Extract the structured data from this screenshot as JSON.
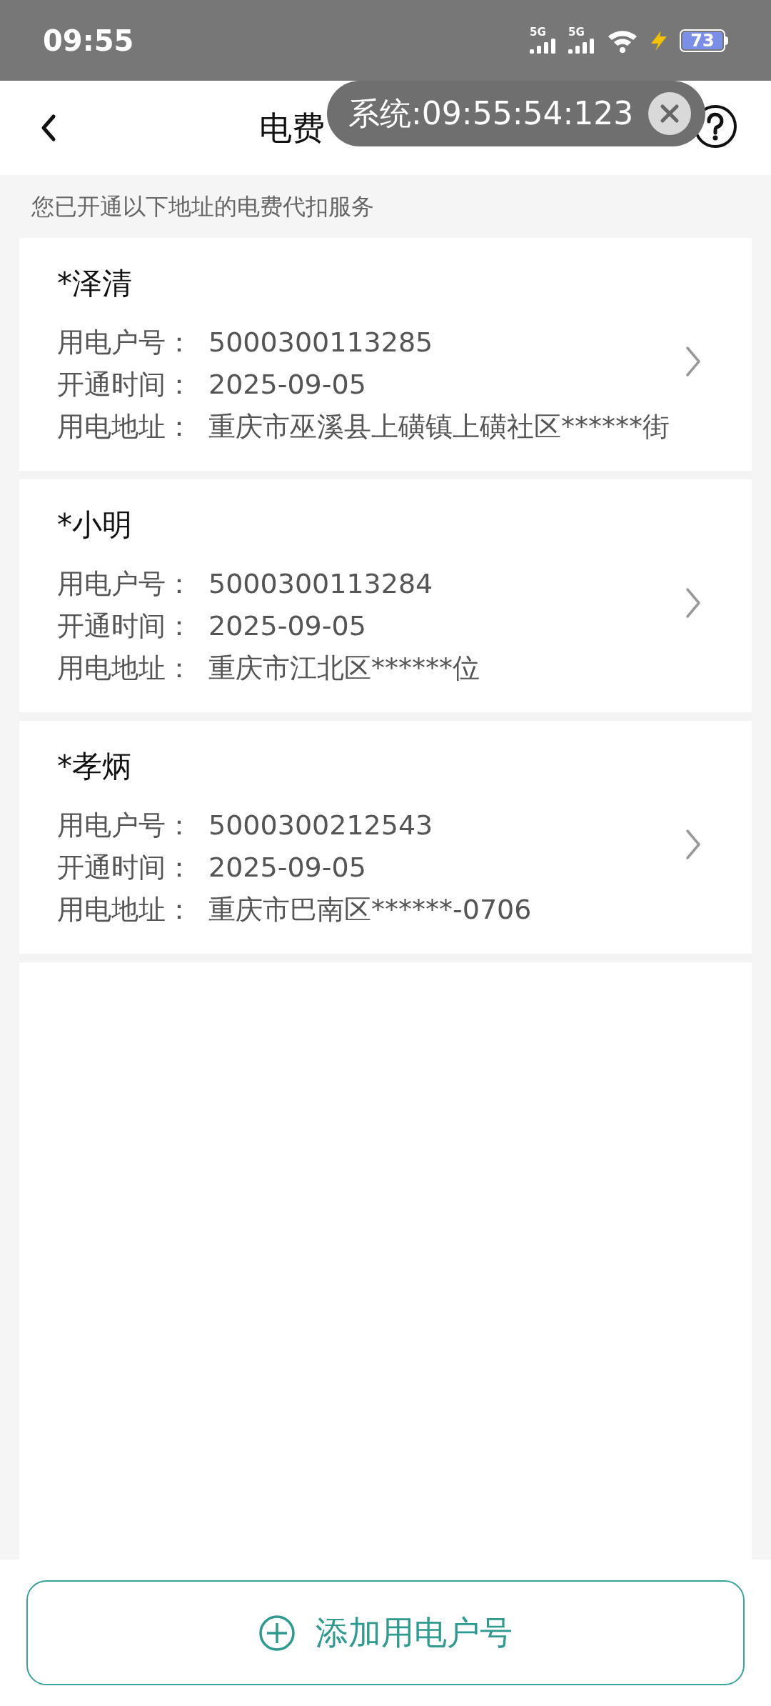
{
  "status_bar": {
    "time": "09:55",
    "network_1": "5G",
    "network_2": "5G",
    "battery": "73"
  },
  "header": {
    "title": "电费"
  },
  "toast": {
    "text": "系统:09:55:54:123"
  },
  "subtitle": "您已开通以下地址的电费代扣服务",
  "accounts": [
    {
      "name": "*泽清",
      "fields": [
        {
          "label": "用电户号：",
          "value": "5000300113285"
        },
        {
          "label": "开通时间：",
          "value": "2025-09-05"
        },
        {
          "label": "用电地址：",
          "value": "重庆市巫溪县上磺镇上磺社区******街"
        }
      ]
    },
    {
      "name": "*小明",
      "fields": [
        {
          "label": "用电户号：",
          "value": "5000300113284"
        },
        {
          "label": "开通时间：",
          "value": "2025-09-05"
        },
        {
          "label": "用电地址：",
          "value": "重庆市江北区******位"
        }
      ]
    },
    {
      "name": "*孝炳",
      "fields": [
        {
          "label": "用电户号：",
          "value": "5000300212543"
        },
        {
          "label": "开通时间：",
          "value": "2025-09-05"
        },
        {
          "label": "用电地址：",
          "value": "重庆市巴南区******-0706"
        }
      ]
    }
  ],
  "add_button": {
    "label": "添加用电户号"
  }
}
